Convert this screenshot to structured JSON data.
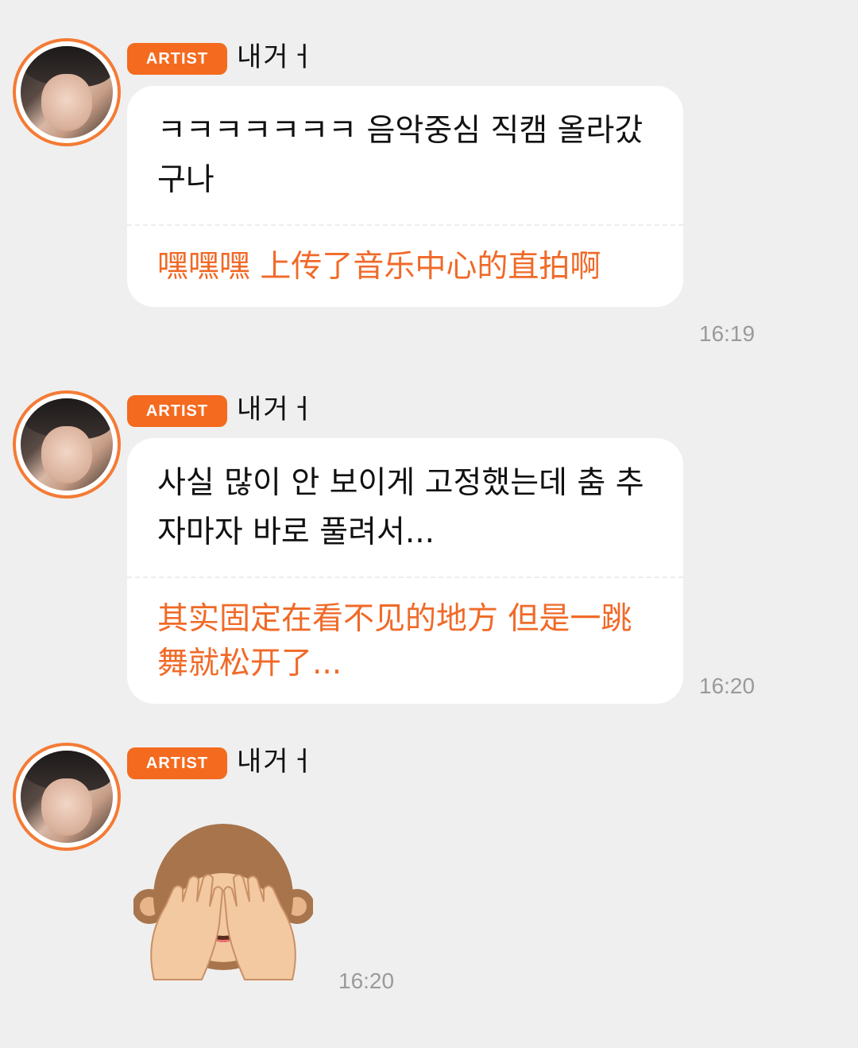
{
  "messages": [
    {
      "badge": "ARTIST",
      "username": "내거ㅓ",
      "korean": "ㅋㅋㅋㅋㅋㅋㅋ 음악중심 직캠 올라갔구나",
      "chinese": "嘿嘿嘿 上传了音乐中心的直拍啊",
      "time": "16:19"
    },
    {
      "badge": "ARTIST",
      "username": "내거ㅓ",
      "korean": "사실 많이 안 보이게 고정했는데 춤 추자마자 바로 풀려서...",
      "chinese": "其实固定在看不见的地方 但是一跳舞就松开了...",
      "time": "16:20"
    },
    {
      "badge": "ARTIST",
      "username": "내거ㅓ",
      "emoji": "see-no-evil-monkey",
      "time": "16:20"
    }
  ],
  "colors": {
    "background": "#efefef",
    "accent": "#f46a1f",
    "translation_text": "#f06a28",
    "time_text": "#9a9a9a",
    "bubble": "#ffffff"
  }
}
